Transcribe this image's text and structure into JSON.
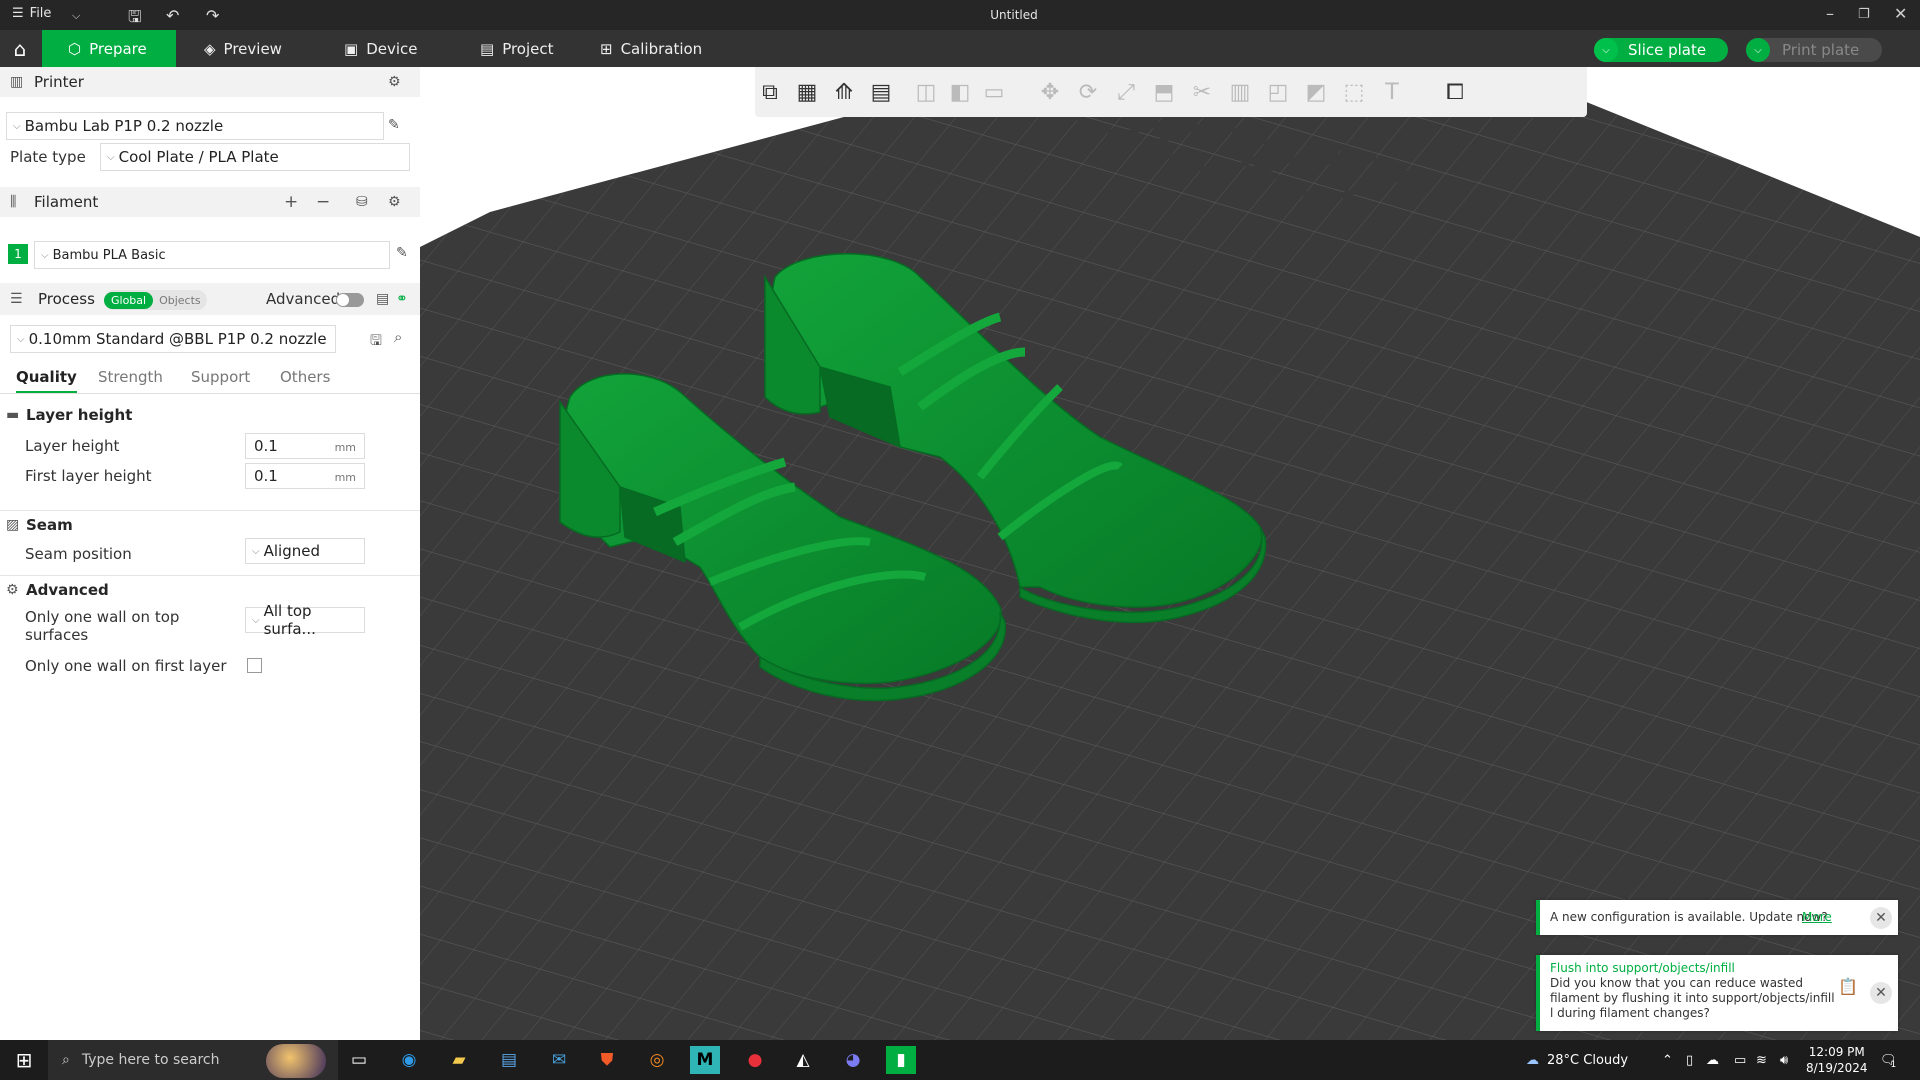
{
  "titlebar": {
    "file_label": "File",
    "title": "Untitled"
  },
  "nav": {
    "tabs": [
      {
        "label": "Prepare",
        "icon": "cube-icon"
      },
      {
        "label": "Preview",
        "icon": "layers-icon"
      },
      {
        "label": "Device",
        "icon": "device-icon"
      },
      {
        "label": "Project",
        "icon": "project-icon"
      },
      {
        "label": "Calibration",
        "icon": "calibration-icon"
      }
    ],
    "slice_label": "Slice plate",
    "print_label": "Print plate"
  },
  "sidebar": {
    "printer": {
      "header": "Printer",
      "printer_name": "Bambu Lab P1P 0.2 nozzle",
      "plate_type_label": "Plate type",
      "plate_type": "Cool Plate / PLA Plate"
    },
    "filament": {
      "header": "Filament",
      "slot": "1",
      "name": "Bambu PLA Basic",
      "slot_color": "#00ae42"
    },
    "process": {
      "header": "Process",
      "global_label": "Global",
      "objects_label": "Objects",
      "advanced_label": "Advanced",
      "preset": "0.10mm Standard @BBL P1P 0.2 nozzle"
    },
    "tabs": [
      "Quality",
      "Strength",
      "Support",
      "Others"
    ],
    "groups": {
      "layer_height": {
        "title": "Layer height",
        "layer_height_label": "Layer height",
        "layer_height_value": "0.1",
        "first_layer_label": "First layer height",
        "first_layer_value": "0.1",
        "unit": "mm"
      },
      "seam": {
        "title": "Seam",
        "seam_position_label": "Seam position",
        "seam_position_value": "Aligned"
      },
      "advanced": {
        "title": "Advanced",
        "one_wall_top_label_1": "Only one wall on top",
        "one_wall_top_label_2": "surfaces",
        "one_wall_top_value": "All top surfa...",
        "one_wall_first_label": "Only one wall on first layer"
      }
    }
  },
  "notifications": {
    "update_text": "A new configuration is available. Update now?",
    "update_link": "More",
    "tip_title": "Flush into support/objects/infill",
    "tip_line1": "Did you know that you can reduce wasted",
    "tip_line2": "filament by flushing it into support/objects/infill",
    "tip_line3": "l during filament changes?"
  },
  "taskbar": {
    "search_placeholder": "Type here to search",
    "weather": "28°C  Cloudy",
    "time": "12:09 PM",
    "date": "8/19/2024",
    "notification_count": "1"
  },
  "colors": {
    "accent": "#00ae42",
    "model": "#0a8f2f",
    "bed": "#3a3a3a"
  }
}
